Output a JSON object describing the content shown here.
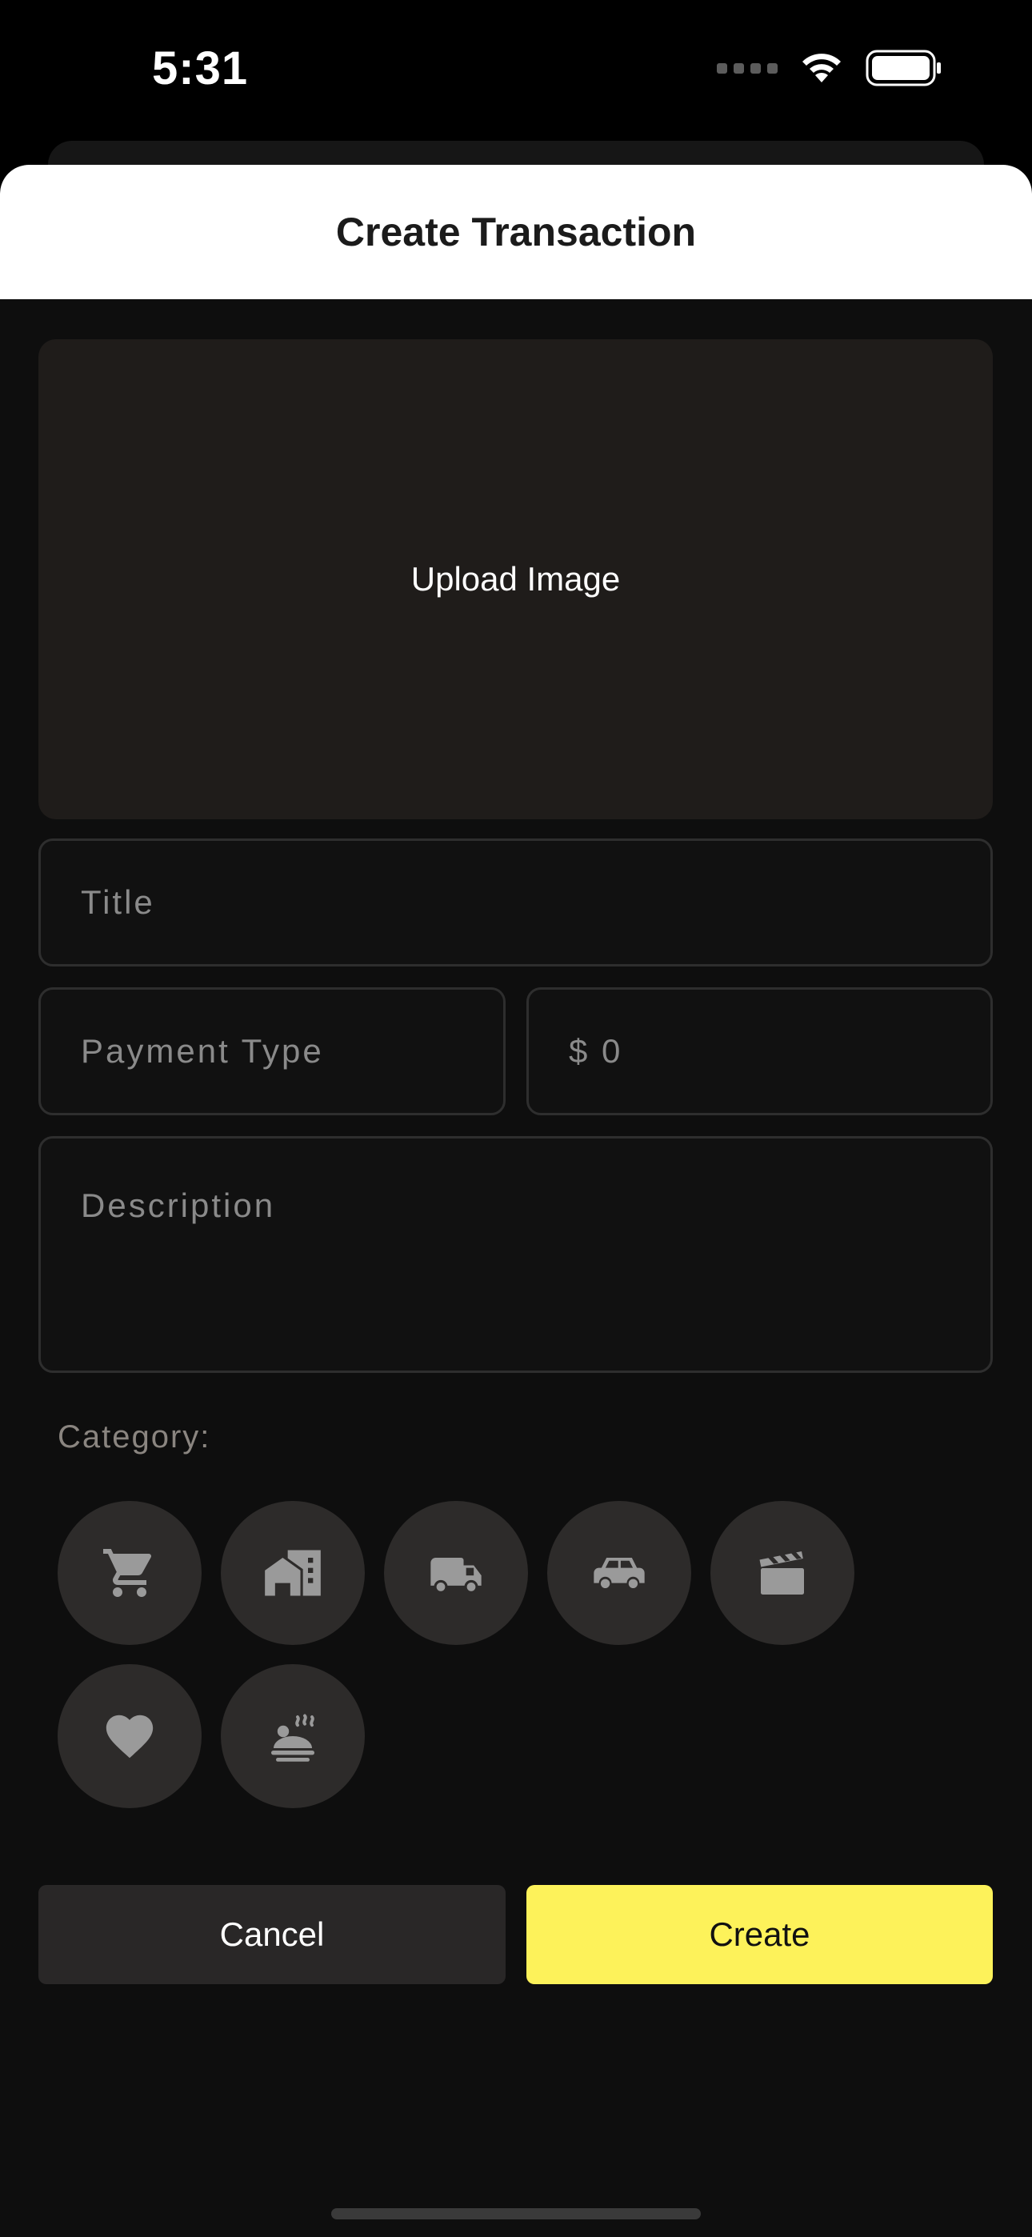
{
  "status_bar": {
    "time": "5:31",
    "icons": [
      "cellular-signal-icon",
      "wifi-icon",
      "battery-icon"
    ]
  },
  "sheet": {
    "title": "Create Transaction"
  },
  "form": {
    "upload_label": "Upload Image",
    "title_placeholder": "Title",
    "payment_type_placeholder": "Payment Type",
    "amount_placeholder": "$ 0",
    "description_placeholder": "Description",
    "category_label": "Category:",
    "categories": [
      {
        "icon": "shopping-cart-icon"
      },
      {
        "icon": "buildings-icon"
      },
      {
        "icon": "delivery-truck-icon"
      },
      {
        "icon": "car-icon"
      },
      {
        "icon": "clapperboard-icon"
      },
      {
        "icon": "heart-icon"
      },
      {
        "icon": "food-dish-icon"
      }
    ]
  },
  "actions": {
    "cancel_label": "Cancel",
    "create_label": "Create"
  },
  "colors": {
    "background": "#0e0e0e",
    "header_bg": "#ffffff",
    "create_accent": "#fdf25a",
    "category_bg": "#2d2b2a",
    "icon_gray": "#9a9a9a"
  }
}
